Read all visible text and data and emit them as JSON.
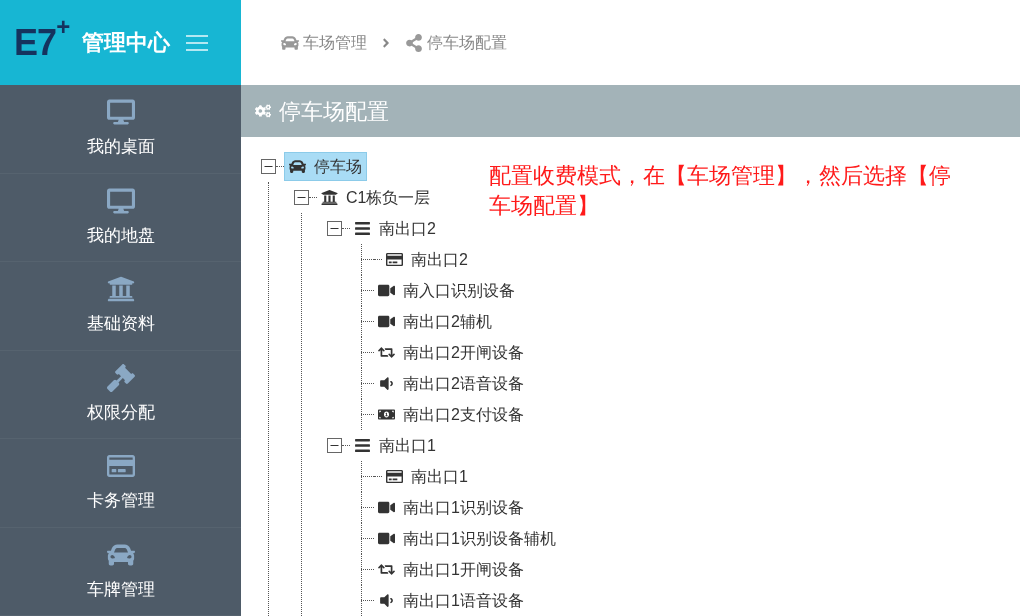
{
  "header": {
    "logo": "E7",
    "logo_sup": "+",
    "title": "管理中心"
  },
  "breadcrumb": [
    {
      "kind": "car",
      "label": "车场管理"
    },
    {
      "kind": "share",
      "label": "停车场配置"
    }
  ],
  "sidebar": {
    "items": [
      {
        "kind": "desktop",
        "label": "我的桌面"
      },
      {
        "kind": "desktop",
        "label": "我的地盘"
      },
      {
        "kind": "bank",
        "label": "基础资料"
      },
      {
        "kind": "gavel",
        "label": "权限分配"
      },
      {
        "kind": "card",
        "label": "卡务管理"
      },
      {
        "kind": "car",
        "label": "车牌管理"
      }
    ]
  },
  "panel": {
    "title": "停车场配置"
  },
  "annotation": "配置收费模式，在【车场管理】，然后选择【停车场配置】",
  "tree": [
    {
      "kind": "car",
      "label": "停车场",
      "selected": true,
      "expanded": true,
      "children": [
        {
          "kind": "bank",
          "label": "C1栋负一层",
          "selected": false,
          "expanded": true,
          "children": [
            {
              "kind": "bars",
              "label": "南出口2",
              "selected": false,
              "expanded": true,
              "children": [
                {
                  "kind": "card",
                  "label": "南出口2",
                  "selected": false
                },
                {
                  "kind": "video",
                  "label": "南入口识别设备",
                  "selected": false
                },
                {
                  "kind": "video",
                  "label": "南出口2辅机",
                  "selected": false
                },
                {
                  "kind": "retweet",
                  "label": "南出口2开闸设备",
                  "selected": false
                },
                {
                  "kind": "volume",
                  "label": "南出口2语音设备",
                  "selected": false
                },
                {
                  "kind": "money",
                  "label": "南出口2支付设备",
                  "selected": false
                }
              ]
            },
            {
              "kind": "bars",
              "label": "南出口1",
              "selected": false,
              "expanded": true,
              "children": [
                {
                  "kind": "card",
                  "label": "南出口1",
                  "selected": false
                },
                {
                  "kind": "video",
                  "label": "南出口1识别设备",
                  "selected": false
                },
                {
                  "kind": "video",
                  "label": "南出口1识别设备辅机",
                  "selected": false
                },
                {
                  "kind": "retweet",
                  "label": "南出口1开闸设备",
                  "selected": false
                },
                {
                  "kind": "volume",
                  "label": "南出口1语音设备",
                  "selected": false
                }
              ]
            }
          ]
        }
      ]
    }
  ]
}
